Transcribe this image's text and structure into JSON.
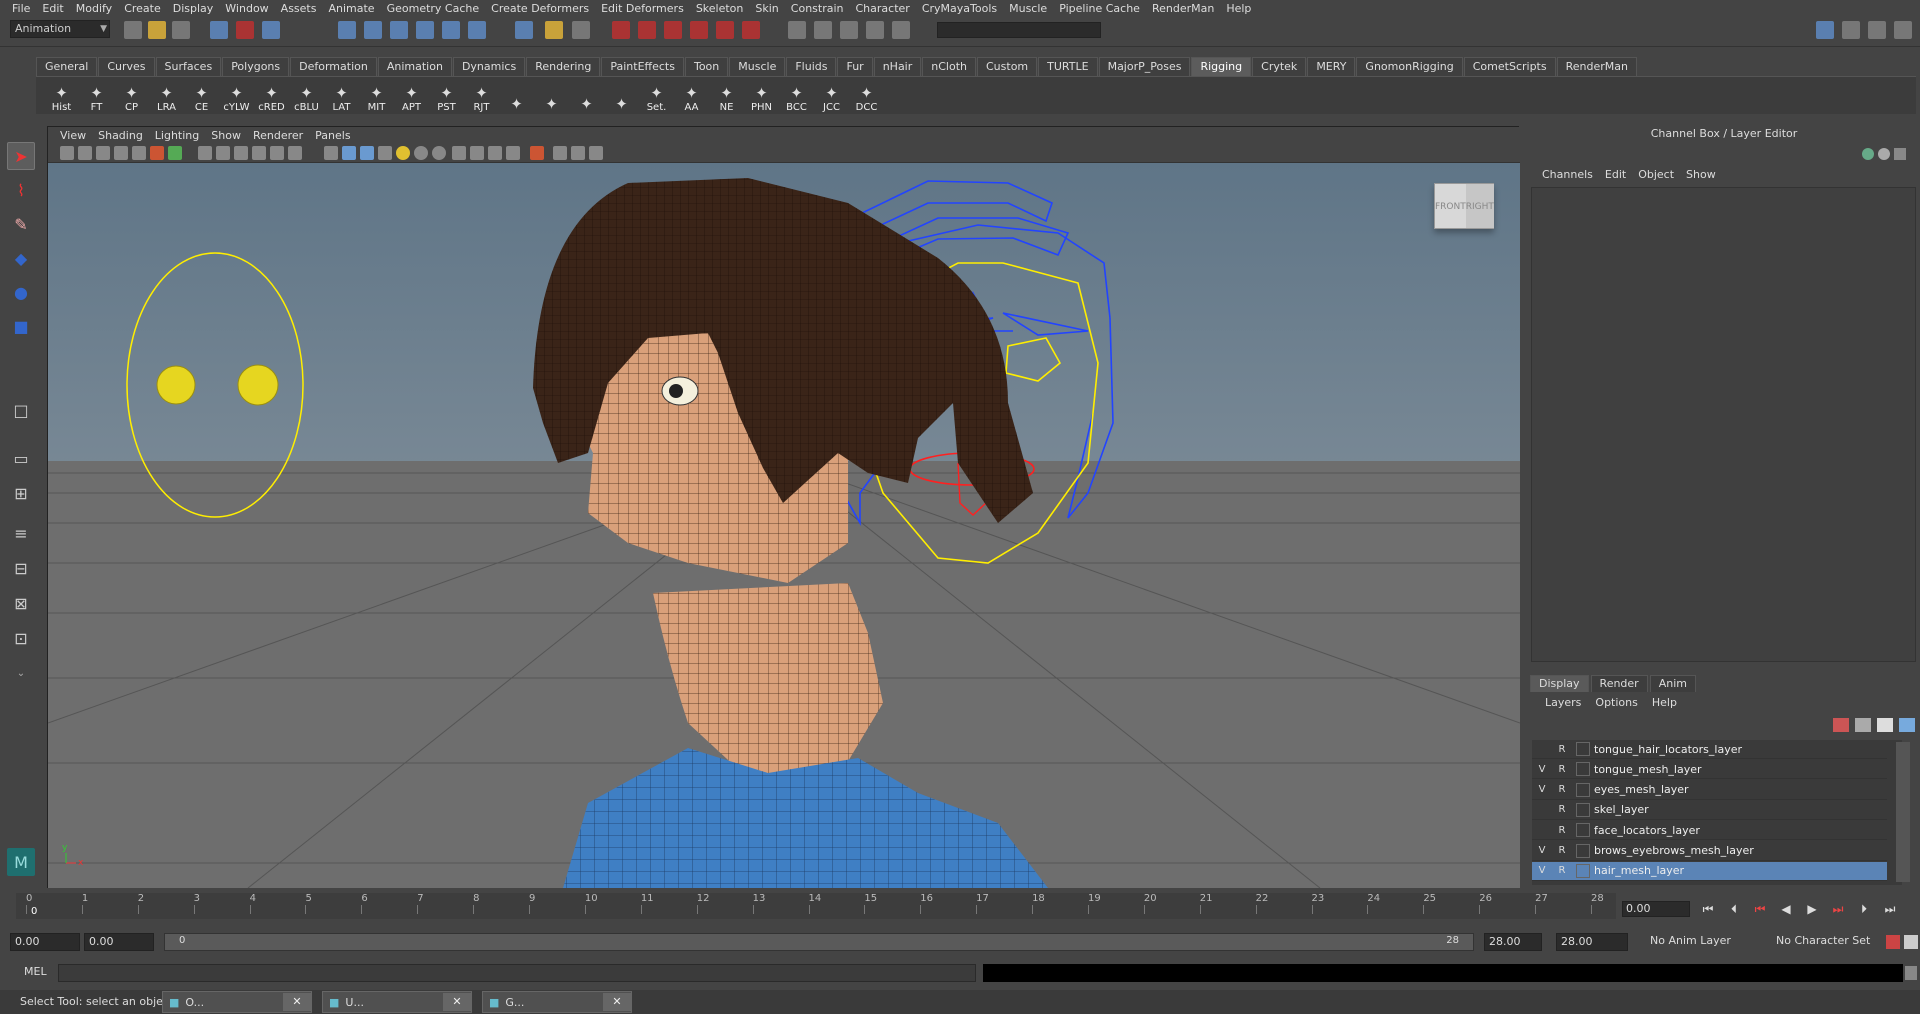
{
  "menubar": [
    "File",
    "Edit",
    "Modify",
    "Create",
    "Display",
    "Window",
    "Assets",
    "Animate",
    "Geometry Cache",
    "Create Deformers",
    "Edit Deformers",
    "Skeleton",
    "Skin",
    "Constrain",
    "Character",
    "CryMayaTools",
    "Muscle",
    "Pipeline Cache",
    "RenderMan",
    "Help"
  ],
  "status": {
    "mode": "Animation"
  },
  "shelf_tabs": [
    "General",
    "Curves",
    "Surfaces",
    "Polygons",
    "Deformation",
    "Animation",
    "Dynamics",
    "Rendering",
    "PaintEffects",
    "Toon",
    "Muscle",
    "Fluids",
    "Fur",
    "nHair",
    "nCloth",
    "Custom",
    "TURTLE",
    "MajorP_Poses",
    "Rigging",
    "Crytek",
    "MERY",
    "GnomonRigging",
    "CometScripts",
    "RenderMan"
  ],
  "active_shelf": "Rigging",
  "shelf_buttons": [
    "Hist",
    "FT",
    "CP",
    "LRA",
    "CE",
    "cYLW",
    "cRED",
    "cBLU",
    "LAT",
    "MIT",
    "APT",
    "PST",
    "RJT",
    "",
    "",
    "",
    "",
    "Set.",
    "AA",
    "NE",
    "PHN",
    "BCC",
    "JCC",
    "DCC"
  ],
  "viewport": {
    "menu": [
      "View",
      "Shading",
      "Lighting",
      "Show",
      "Renderer",
      "Panels"
    ],
    "viewcube_front": "FRONT",
    "viewcube_right": "RIGHT",
    "axis_x": "x",
    "axis_y": "y"
  },
  "channel_box": {
    "title": "Channel Box / Layer Editor",
    "menu": [
      "Channels",
      "Edit",
      "Object",
      "Show"
    ]
  },
  "layer_editor": {
    "tabs": [
      "Display",
      "Render",
      "Anim"
    ],
    "active_tab": "Display",
    "menu": [
      "Layers",
      "Options",
      "Help"
    ],
    "layers": [
      {
        "v": "",
        "r": "R",
        "name": "tongue_hair_locators_layer",
        "selected": false
      },
      {
        "v": "V",
        "r": "R",
        "name": "tongue_mesh_layer",
        "selected": false
      },
      {
        "v": "V",
        "r": "R",
        "name": "eyes_mesh_layer",
        "selected": false
      },
      {
        "v": "",
        "r": "R",
        "name": "skel_layer",
        "selected": false
      },
      {
        "v": "",
        "r": "R",
        "name": "face_locators_layer",
        "selected": false
      },
      {
        "v": "V",
        "r": "R",
        "name": "brows_eyebrows_mesh_layer",
        "selected": false
      },
      {
        "v": "V",
        "r": "R",
        "name": "hair_mesh_layer",
        "selected": true
      }
    ]
  },
  "timeline": {
    "ticks": [
      "0",
      "1",
      "2",
      "3",
      "4",
      "5",
      "6",
      "7",
      "8",
      "9",
      "10",
      "11",
      "12",
      "13",
      "14",
      "15",
      "16",
      "17",
      "18",
      "19",
      "20",
      "21",
      "22",
      "23",
      "24",
      "25",
      "26",
      "27",
      "28"
    ],
    "current_frame_marker": "0",
    "current_time": "0.00"
  },
  "range": {
    "start": "0.00",
    "anim_start": "0.00",
    "slider_start": "0",
    "slider_end": "28",
    "end": "28.00",
    "anim_end": "28.00",
    "anim_layer": "No Anim Layer",
    "char_set": "No Character Set"
  },
  "cmdline": {
    "label": "MEL"
  },
  "helpline": {
    "text": "Select Tool: select an object"
  },
  "taskbar": [
    "O...",
    "U...",
    "G..."
  ],
  "colors": {
    "selected_layer": "#5b84b6",
    "ctrl_yellow": "#ffee00",
    "ctrl_blue": "#2244ff",
    "ctrl_red": "#ff2020",
    "ctrl_green": "#22cc22",
    "skin": "#d9a07a",
    "shirt": "#3f7fc4",
    "hair": "#3a2418"
  }
}
